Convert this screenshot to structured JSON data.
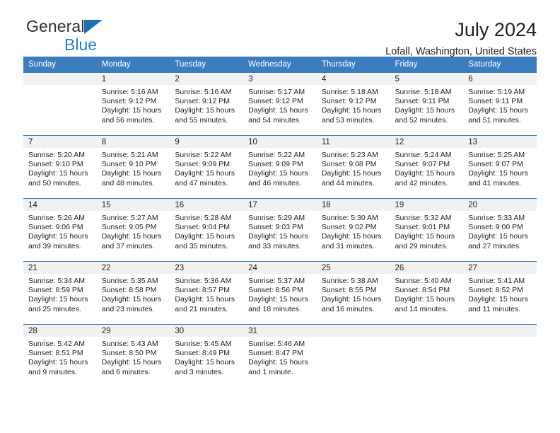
{
  "brand": {
    "name_part1": "General",
    "name_part2": "Blue",
    "triangle_color": "#1f6fb5",
    "blue_color": "#1f85d8"
  },
  "header": {
    "title": "July 2024",
    "subtitle": "Lofall, Washington, United States"
  },
  "theme": {
    "header_bg": "#3a7ebf",
    "daynum_bg": "#f1f1f1",
    "text": "#231f20"
  },
  "weekdays": [
    "Sunday",
    "Monday",
    "Tuesday",
    "Wednesday",
    "Thursday",
    "Friday",
    "Saturday"
  ],
  "weeks": [
    [
      {
        "day": "",
        "sunrise": "",
        "sunset": "",
        "daylight1": "",
        "daylight2": ""
      },
      {
        "day": "1",
        "sunrise": "Sunrise: 5:16 AM",
        "sunset": "Sunset: 9:12 PM",
        "daylight1": "Daylight: 15 hours",
        "daylight2": "and 56 minutes."
      },
      {
        "day": "2",
        "sunrise": "Sunrise: 5:16 AM",
        "sunset": "Sunset: 9:12 PM",
        "daylight1": "Daylight: 15 hours",
        "daylight2": "and 55 minutes."
      },
      {
        "day": "3",
        "sunrise": "Sunrise: 5:17 AM",
        "sunset": "Sunset: 9:12 PM",
        "daylight1": "Daylight: 15 hours",
        "daylight2": "and 54 minutes."
      },
      {
        "day": "4",
        "sunrise": "Sunrise: 5:18 AM",
        "sunset": "Sunset: 9:12 PM",
        "daylight1": "Daylight: 15 hours",
        "daylight2": "and 53 minutes."
      },
      {
        "day": "5",
        "sunrise": "Sunrise: 5:18 AM",
        "sunset": "Sunset: 9:11 PM",
        "daylight1": "Daylight: 15 hours",
        "daylight2": "and 52 minutes."
      },
      {
        "day": "6",
        "sunrise": "Sunrise: 5:19 AM",
        "sunset": "Sunset: 9:11 PM",
        "daylight1": "Daylight: 15 hours",
        "daylight2": "and 51 minutes."
      }
    ],
    [
      {
        "day": "7",
        "sunrise": "Sunrise: 5:20 AM",
        "sunset": "Sunset: 9:10 PM",
        "daylight1": "Daylight: 15 hours",
        "daylight2": "and 50 minutes."
      },
      {
        "day": "8",
        "sunrise": "Sunrise: 5:21 AM",
        "sunset": "Sunset: 9:10 PM",
        "daylight1": "Daylight: 15 hours",
        "daylight2": "and 48 minutes."
      },
      {
        "day": "9",
        "sunrise": "Sunrise: 5:22 AM",
        "sunset": "Sunset: 9:09 PM",
        "daylight1": "Daylight: 15 hours",
        "daylight2": "and 47 minutes."
      },
      {
        "day": "10",
        "sunrise": "Sunrise: 5:22 AM",
        "sunset": "Sunset: 9:09 PM",
        "daylight1": "Daylight: 15 hours",
        "daylight2": "and 46 minutes."
      },
      {
        "day": "11",
        "sunrise": "Sunrise: 5:23 AM",
        "sunset": "Sunset: 9:08 PM",
        "daylight1": "Daylight: 15 hours",
        "daylight2": "and 44 minutes."
      },
      {
        "day": "12",
        "sunrise": "Sunrise: 5:24 AM",
        "sunset": "Sunset: 9:07 PM",
        "daylight1": "Daylight: 15 hours",
        "daylight2": "and 42 minutes."
      },
      {
        "day": "13",
        "sunrise": "Sunrise: 5:25 AM",
        "sunset": "Sunset: 9:07 PM",
        "daylight1": "Daylight: 15 hours",
        "daylight2": "and 41 minutes."
      }
    ],
    [
      {
        "day": "14",
        "sunrise": "Sunrise: 5:26 AM",
        "sunset": "Sunset: 9:06 PM",
        "daylight1": "Daylight: 15 hours",
        "daylight2": "and 39 minutes."
      },
      {
        "day": "15",
        "sunrise": "Sunrise: 5:27 AM",
        "sunset": "Sunset: 9:05 PM",
        "daylight1": "Daylight: 15 hours",
        "daylight2": "and 37 minutes."
      },
      {
        "day": "16",
        "sunrise": "Sunrise: 5:28 AM",
        "sunset": "Sunset: 9:04 PM",
        "daylight1": "Daylight: 15 hours",
        "daylight2": "and 35 minutes."
      },
      {
        "day": "17",
        "sunrise": "Sunrise: 5:29 AM",
        "sunset": "Sunset: 9:03 PM",
        "daylight1": "Daylight: 15 hours",
        "daylight2": "and 33 minutes."
      },
      {
        "day": "18",
        "sunrise": "Sunrise: 5:30 AM",
        "sunset": "Sunset: 9:02 PM",
        "daylight1": "Daylight: 15 hours",
        "daylight2": "and 31 minutes."
      },
      {
        "day": "19",
        "sunrise": "Sunrise: 5:32 AM",
        "sunset": "Sunset: 9:01 PM",
        "daylight1": "Daylight: 15 hours",
        "daylight2": "and 29 minutes."
      },
      {
        "day": "20",
        "sunrise": "Sunrise: 5:33 AM",
        "sunset": "Sunset: 9:00 PM",
        "daylight1": "Daylight: 15 hours",
        "daylight2": "and 27 minutes."
      }
    ],
    [
      {
        "day": "21",
        "sunrise": "Sunrise: 5:34 AM",
        "sunset": "Sunset: 8:59 PM",
        "daylight1": "Daylight: 15 hours",
        "daylight2": "and 25 minutes."
      },
      {
        "day": "22",
        "sunrise": "Sunrise: 5:35 AM",
        "sunset": "Sunset: 8:58 PM",
        "daylight1": "Daylight: 15 hours",
        "daylight2": "and 23 minutes."
      },
      {
        "day": "23",
        "sunrise": "Sunrise: 5:36 AM",
        "sunset": "Sunset: 8:57 PM",
        "daylight1": "Daylight: 15 hours",
        "daylight2": "and 21 minutes."
      },
      {
        "day": "24",
        "sunrise": "Sunrise: 5:37 AM",
        "sunset": "Sunset: 8:56 PM",
        "daylight1": "Daylight: 15 hours",
        "daylight2": "and 18 minutes."
      },
      {
        "day": "25",
        "sunrise": "Sunrise: 5:38 AM",
        "sunset": "Sunset: 8:55 PM",
        "daylight1": "Daylight: 15 hours",
        "daylight2": "and 16 minutes."
      },
      {
        "day": "26",
        "sunrise": "Sunrise: 5:40 AM",
        "sunset": "Sunset: 8:54 PM",
        "daylight1": "Daylight: 15 hours",
        "daylight2": "and 14 minutes."
      },
      {
        "day": "27",
        "sunrise": "Sunrise: 5:41 AM",
        "sunset": "Sunset: 8:52 PM",
        "daylight1": "Daylight: 15 hours",
        "daylight2": "and 11 minutes."
      }
    ],
    [
      {
        "day": "28",
        "sunrise": "Sunrise: 5:42 AM",
        "sunset": "Sunset: 8:51 PM",
        "daylight1": "Daylight: 15 hours",
        "daylight2": "and 9 minutes."
      },
      {
        "day": "29",
        "sunrise": "Sunrise: 5:43 AM",
        "sunset": "Sunset: 8:50 PM",
        "daylight1": "Daylight: 15 hours",
        "daylight2": "and 6 minutes."
      },
      {
        "day": "30",
        "sunrise": "Sunrise: 5:45 AM",
        "sunset": "Sunset: 8:49 PM",
        "daylight1": "Daylight: 15 hours",
        "daylight2": "and 3 minutes."
      },
      {
        "day": "31",
        "sunrise": "Sunrise: 5:46 AM",
        "sunset": "Sunset: 8:47 PM",
        "daylight1": "Daylight: 15 hours",
        "daylight2": "and 1 minute."
      },
      {
        "day": "",
        "sunrise": "",
        "sunset": "",
        "daylight1": "",
        "daylight2": ""
      },
      {
        "day": "",
        "sunrise": "",
        "sunset": "",
        "daylight1": "",
        "daylight2": ""
      },
      {
        "day": "",
        "sunrise": "",
        "sunset": "",
        "daylight1": "",
        "daylight2": ""
      }
    ]
  ]
}
